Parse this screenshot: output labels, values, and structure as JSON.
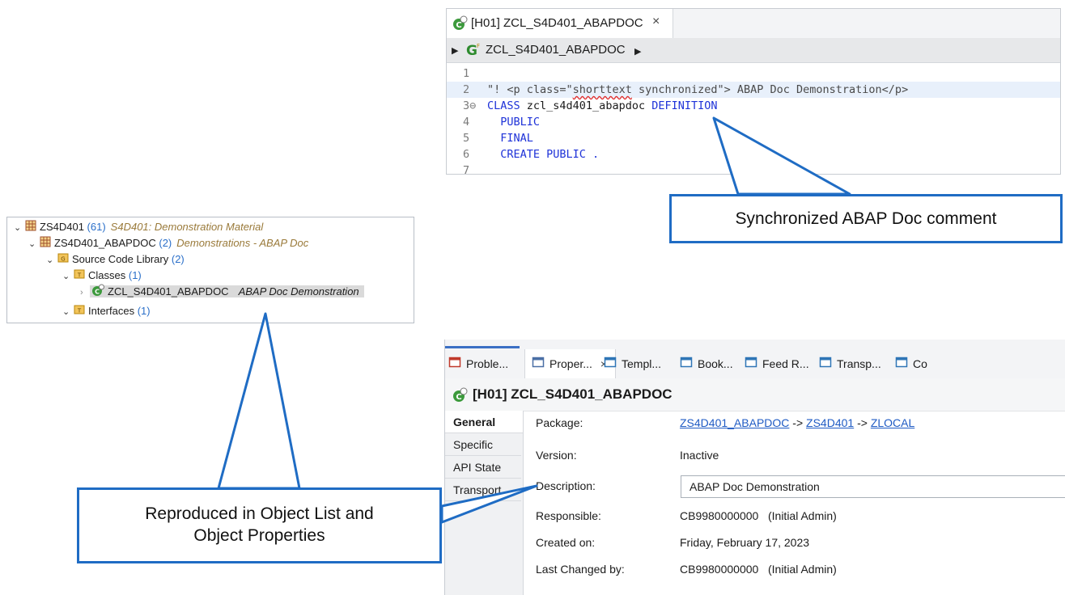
{
  "editor": {
    "tab_title": "[H01] ZCL_S4D401_ABAPDOC",
    "tab_close": "×",
    "breadcrumb": "ZCL_S4D401_ABAPDOC",
    "lines": [
      {
        "n": "1",
        "parts": []
      },
      {
        "n": "2",
        "parts": [
          {
            "t": "\"! <p class=\"",
            "c": "cm"
          },
          {
            "t": "shorttext",
            "c": "cm sq"
          },
          {
            "t": " synchronized\"> ABAP Doc Demonstration</p>",
            "c": "cm"
          }
        ]
      },
      {
        "n": "3⊖",
        "parts": [
          {
            "t": "CLASS ",
            "c": "kw"
          },
          {
            "t": "zcl_s4d401_abapdoc ",
            "c": ""
          },
          {
            "t": "DEFINITION",
            "c": "kw"
          }
        ]
      },
      {
        "n": "4",
        "parts": [
          {
            "t": "  PUBLIC",
            "c": "kw"
          }
        ]
      },
      {
        "n": "5",
        "parts": [
          {
            "t": "  FINAL",
            "c": "kw"
          }
        ]
      },
      {
        "n": "6",
        "parts": [
          {
            "t": "  CREATE PUBLIC .",
            "c": "kw"
          }
        ]
      },
      {
        "n": "7",
        "parts": []
      }
    ]
  },
  "callouts": {
    "editor_note": "Synchronized ABAP Doc comment",
    "list_note_line1": "Reproduced in Object List and",
    "list_note_line2": "Object Properties"
  },
  "tree": {
    "package": {
      "name": "ZS4D401",
      "count": "(61)",
      "desc": "S4D401: Demonstration Material"
    },
    "subpackage": {
      "name": "ZS4D401_ABAPDOC",
      "count": "(2)",
      "desc": "Demonstrations - ABAP Doc"
    },
    "library": {
      "name": "Source Code Library",
      "count": "(2)"
    },
    "classes": {
      "name": "Classes",
      "count": "(1)"
    },
    "class_item": {
      "name": "ZCL_S4D401_ABAPDOC",
      "desc": "ABAP Doc Demonstration"
    },
    "interfaces": {
      "name": "Interfaces",
      "count": "(1)"
    }
  },
  "props": {
    "tabs": [
      {
        "label": "Proble...",
        "icon": "problems-icon"
      },
      {
        "label": "Proper...",
        "icon": "properties-icon",
        "close": "×"
      },
      {
        "label": "Templ...",
        "icon": "templates-icon"
      },
      {
        "label": "Book...",
        "icon": "bookmarks-icon"
      },
      {
        "label": "Feed R...",
        "icon": "feed-reader-icon"
      },
      {
        "label": "Transp...",
        "icon": "transport-icon"
      },
      {
        "label": "Co",
        "icon": "console-icon"
      }
    ],
    "title": "[H01] ZCL_S4D401_ABAPDOC",
    "side_tabs": [
      "General",
      "Specific",
      "API State",
      "Transport"
    ],
    "package_label": "Package:",
    "package_links": [
      "ZS4D401_ABAPDOC",
      "ZS4D401",
      "ZLOCAL"
    ],
    "arrow": "->",
    "version_label": "Version:",
    "version_value": "Inactive",
    "description_label": "Description:",
    "description_value": "ABAP Doc Demonstration",
    "responsible_label": "Responsible:",
    "responsible_value": "CB9980000000   (Initial Admin)",
    "created_label": "Created on:",
    "created_value": "Friday, February 17, 2023",
    "changed_label": "Last Changed by:",
    "changed_value": "CB9980000000   (Initial Admin)"
  },
  "colors": {
    "callout_border": "#1f6cc4",
    "keyword": "#1e32d8",
    "link": "#1f5bc4",
    "tree_count": "#2a6fc9"
  }
}
